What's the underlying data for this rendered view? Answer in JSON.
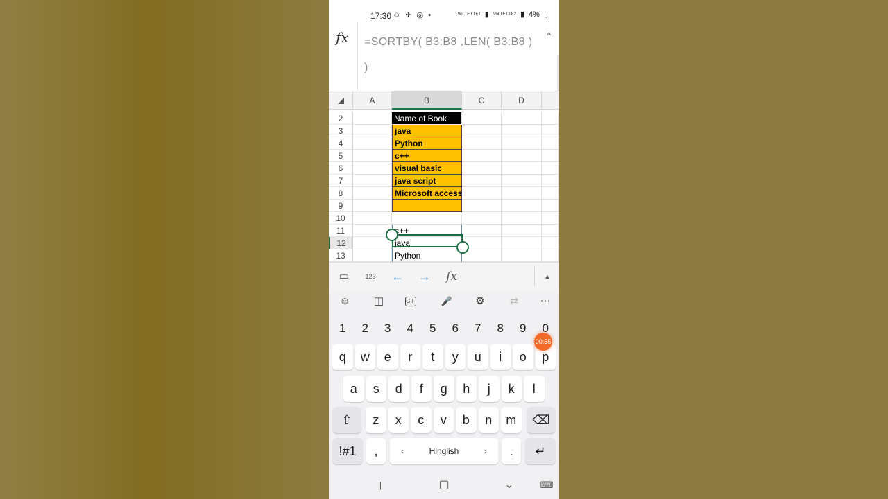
{
  "status": {
    "time": "17:30",
    "left_icons": "☺ ✈ ◎ •",
    "network1": "VoLTE LTE1",
    "network2": "VoLTE LTE2",
    "battery": "4%"
  },
  "formula_bar": {
    "fx": "fx",
    "text": "=SORTBY( B3:B8 ,LEN( B3:B8 ) )",
    "collapse_icon": "^"
  },
  "columns": [
    "A",
    "B",
    "C",
    "D"
  ],
  "rows": [
    {
      "num": "2",
      "b": "Name of Book",
      "style": "head"
    },
    {
      "num": "3",
      "b": "java",
      "style": "orange"
    },
    {
      "num": "4",
      "b": "Python",
      "style": "orange"
    },
    {
      "num": "5",
      "b": "c++",
      "style": "orange"
    },
    {
      "num": "6",
      "b": "visual basic",
      "style": "orange"
    },
    {
      "num": "7",
      "b": "java script",
      "style": "orange"
    },
    {
      "num": "8",
      "b": "Microsoft access",
      "style": "orange"
    },
    {
      "num": "9",
      "b": "",
      "style": "orange"
    },
    {
      "num": "10",
      "b": "",
      "style": "plain"
    },
    {
      "num": "11",
      "b": "c++",
      "style": "result"
    },
    {
      "num": "12",
      "b": "java",
      "style": "result"
    },
    {
      "num": "13",
      "b": "Python",
      "style": "result"
    }
  ],
  "toolbar": {
    "sheet_icon": "▭",
    "keyboard_icon": "123",
    "back_arrow": "←",
    "forward_arrow": "→",
    "fx": "fx",
    "expand": "▲"
  },
  "keyboard": {
    "tools": [
      "☺",
      "◫",
      "GIF",
      "🎤",
      "⚙",
      "⇄",
      "⋯"
    ],
    "numbers": [
      "1",
      "2",
      "3",
      "4",
      "5",
      "6",
      "7",
      "8",
      "9",
      "0"
    ],
    "row1": [
      "q",
      "w",
      "e",
      "r",
      "t",
      "y",
      "u",
      "i",
      "o",
      "p"
    ],
    "row2": [
      "a",
      "s",
      "d",
      "f",
      "g",
      "h",
      "j",
      "k",
      "l"
    ],
    "row3": [
      "z",
      "x",
      "c",
      "v",
      "b",
      "n",
      "m"
    ],
    "shift": "⇧",
    "backspace": "⌫",
    "symbols": "!#1",
    "comma": ",",
    "space_label": "Hinglish",
    "space_left": "‹",
    "space_right": "›",
    "period": ".",
    "enter": "↵"
  },
  "timer": "00:55",
  "navbar": {
    "recent": "|||",
    "home": "▢",
    "back": "⌄",
    "keyboard": "⌨"
  }
}
